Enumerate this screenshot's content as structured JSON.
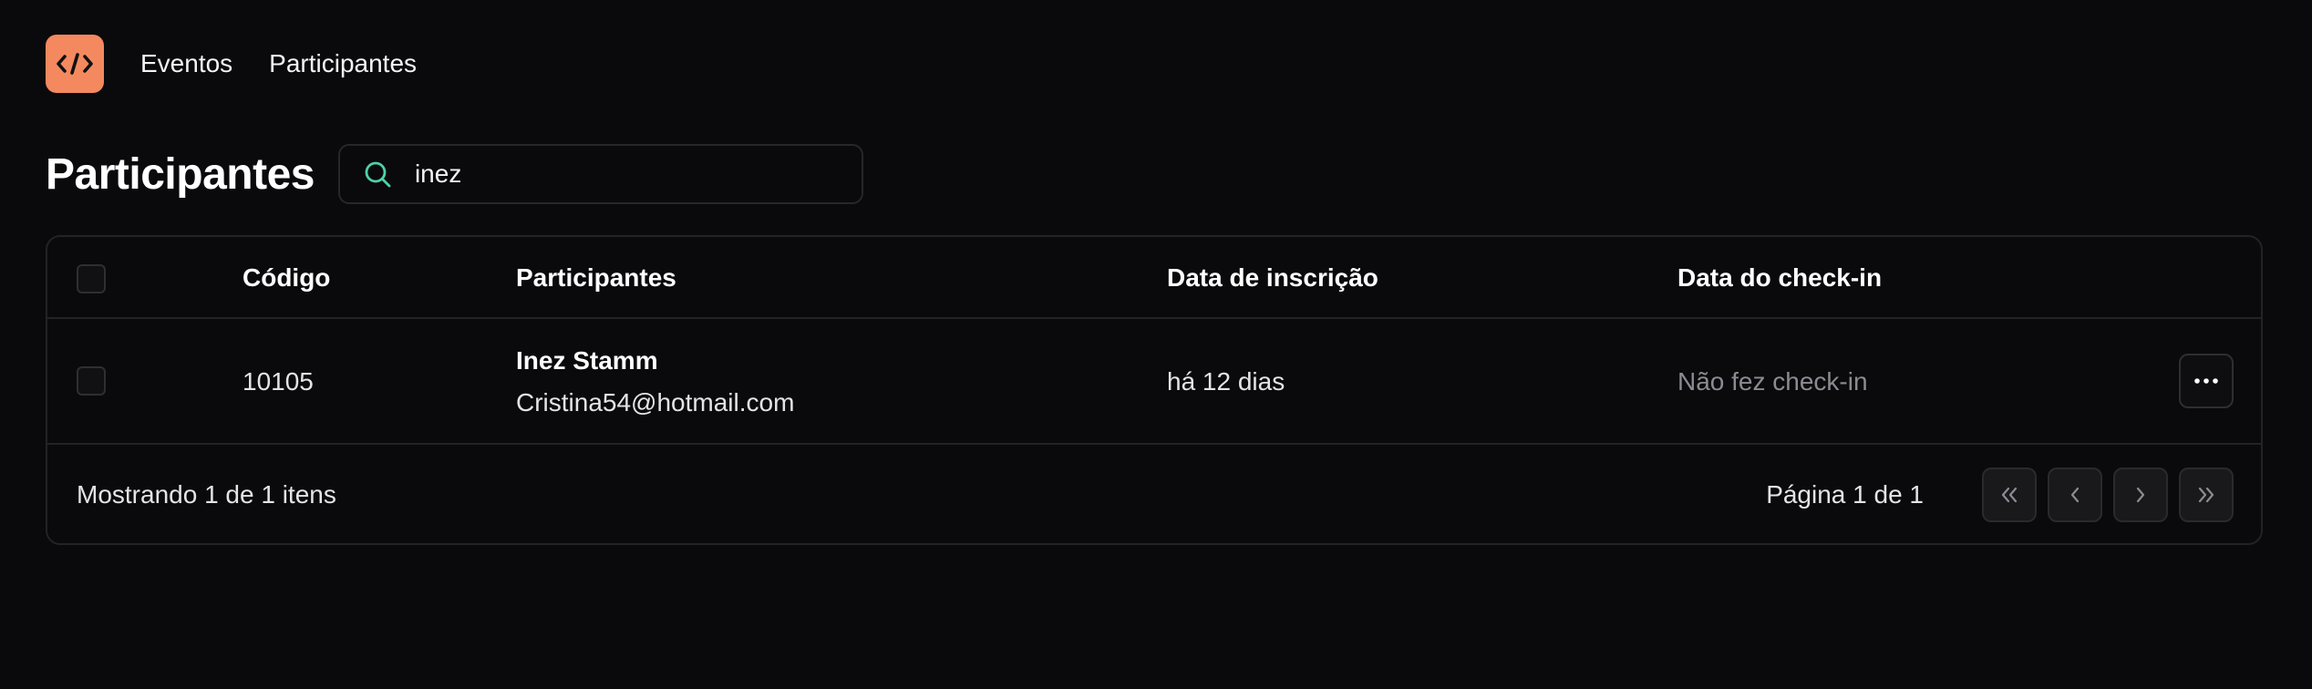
{
  "nav": {
    "logo_icon": "code-icon",
    "items": [
      {
        "label": "Eventos"
      },
      {
        "label": "Participantes"
      }
    ]
  },
  "page": {
    "title": "Participantes",
    "search": {
      "value": "inez",
      "icon": "search-icon"
    }
  },
  "table": {
    "columns": [
      "Código",
      "Participantes",
      "Data de inscrição",
      "Data do check-in"
    ],
    "rows": [
      {
        "code": "10105",
        "name": "Inez Stamm",
        "email": "Cristina54@hotmail.com",
        "registered": "há 12 dias",
        "checkin": "Não fez check-in"
      }
    ]
  },
  "footer": {
    "showing": "Mostrando 1 de 1 itens",
    "page_info": "Página 1 de 1"
  },
  "colors": {
    "background": "#0a0a0c",
    "accent": "#f4895f",
    "search_icon": "#4fd1a5",
    "border": "#232326"
  }
}
